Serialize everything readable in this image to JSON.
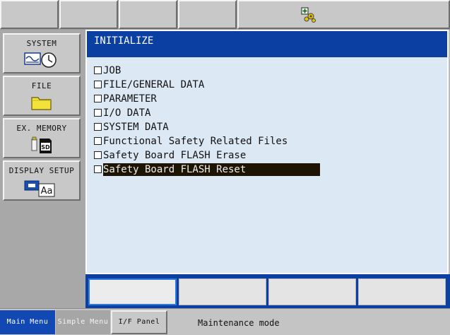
{
  "toolbar": {
    "buttons": [
      "",
      "",
      "",
      ""
    ],
    "status_icon": "servo-gear-icon"
  },
  "side_menu": [
    {
      "label": "SYSTEM",
      "icon": "system-clock-wave-icon"
    },
    {
      "label": "FILE",
      "icon": "folder-icon"
    },
    {
      "label": "EX. MEMORY",
      "icon": "sd-card-usb-icon"
    },
    {
      "label": "DISPLAY SETUP",
      "icon": "display-font-icon",
      "icon_text": "Aa"
    }
  ],
  "main": {
    "title": "INITIALIZE",
    "items": [
      {
        "label": "JOB",
        "selected": false
      },
      {
        "label": "FILE/GENERAL DATA",
        "selected": false
      },
      {
        "label": "PARAMETER",
        "selected": false
      },
      {
        "label": "I/O DATA",
        "selected": false
      },
      {
        "label": "SYSTEM DATA",
        "selected": false
      },
      {
        "label": "Functional Safety Related Files",
        "selected": false
      },
      {
        "label": "Safety Board FLASH Erase",
        "selected": false
      },
      {
        "label": "Safety Board FLASH Reset",
        "selected": true
      }
    ]
  },
  "function_keys": [
    "",
    "",
    "",
    ""
  ],
  "status_bar": {
    "main_menu": "Main Menu",
    "simple_menu": "Simple Menu",
    "if_panel": "I/F Panel",
    "message": "Maintenance mode"
  },
  "colors": {
    "title_bar": "#0c3fa2",
    "list_background": "#dde8f5",
    "selection": "#1e1404",
    "active_tab": "#1248b4"
  }
}
